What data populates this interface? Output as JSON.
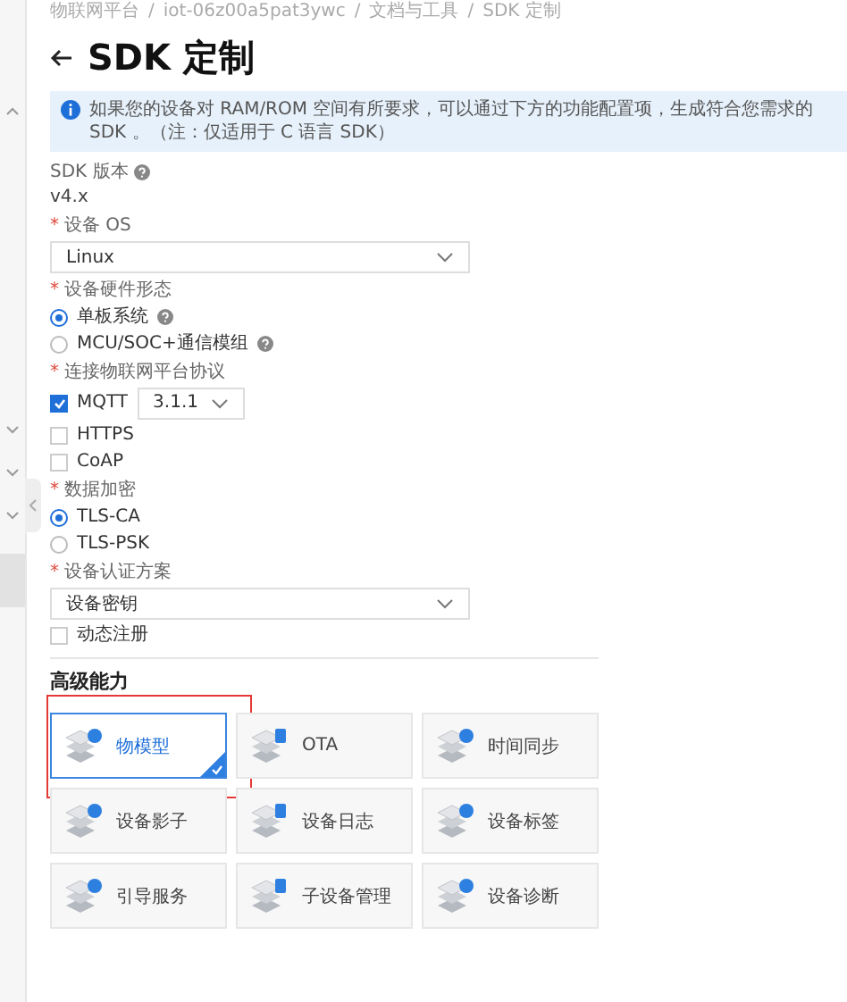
{
  "breadcrumb": [
    "物联网平台",
    "iot-06z00a5pat3ywc",
    "文档与工具",
    "SDK 定制"
  ],
  "breadcrumb_separator": "/",
  "required_mark": "*",
  "title": "SDK 定制",
  "alert": "如果您的设备对 RAM/ROM 空间有所要求，可以通过下方的功能配置项，生成符合您需求的 SDK 。（注：仅适用于 C 语言 SDK）",
  "sdk_version": {
    "label": "SDK 版本",
    "value": "v4.x"
  },
  "form": [
    {
      "kind": "select",
      "label": "设备 OS",
      "required": true,
      "value": "Linux"
    },
    {
      "kind": "radio",
      "label": "设备硬件形态",
      "required": true,
      "options": [
        {
          "label": "单板系统",
          "selected": true,
          "help": true
        },
        {
          "label": "MCU/SOC+通信模组",
          "selected": false,
          "help": true
        }
      ]
    },
    {
      "kind": "checkbox",
      "label": "连接物联网平台协议",
      "required": true,
      "options": [
        {
          "label": "MQTT",
          "checked": true,
          "version": "3.1.1"
        },
        {
          "label": "HTTPS",
          "checked": false
        },
        {
          "label": "CoAP",
          "checked": false
        }
      ]
    },
    {
      "kind": "radio",
      "label": "数据加密",
      "required": true,
      "options": [
        {
          "label": "TLS-CA",
          "selected": true
        },
        {
          "label": "TLS-PSK",
          "selected": false
        }
      ]
    },
    {
      "kind": "select",
      "label": "设备认证方案",
      "required": true,
      "value": "设备密钥",
      "options": [
        {
          "label": "动态注册",
          "checked": false
        }
      ]
    }
  ],
  "advanced": {
    "title": "高级能力",
    "items": [
      {
        "label": "物模型",
        "selected": true,
        "highlighted": true
      },
      {
        "label": "OTA",
        "selected": false,
        "highlighted": false
      },
      {
        "label": "时间同步",
        "selected": false,
        "highlighted": false
      },
      {
        "label": "设备影子",
        "selected": false,
        "highlighted": false
      },
      {
        "label": "设备日志",
        "selected": false,
        "highlighted": false
      },
      {
        "label": "设备标签",
        "selected": false,
        "highlighted": false
      },
      {
        "label": "引导服务",
        "selected": false,
        "highlighted": false
      },
      {
        "label": "子设备管理",
        "selected": false,
        "highlighted": false
      },
      {
        "label": "设备诊断",
        "selected": false,
        "highlighted": false
      }
    ]
  }
}
